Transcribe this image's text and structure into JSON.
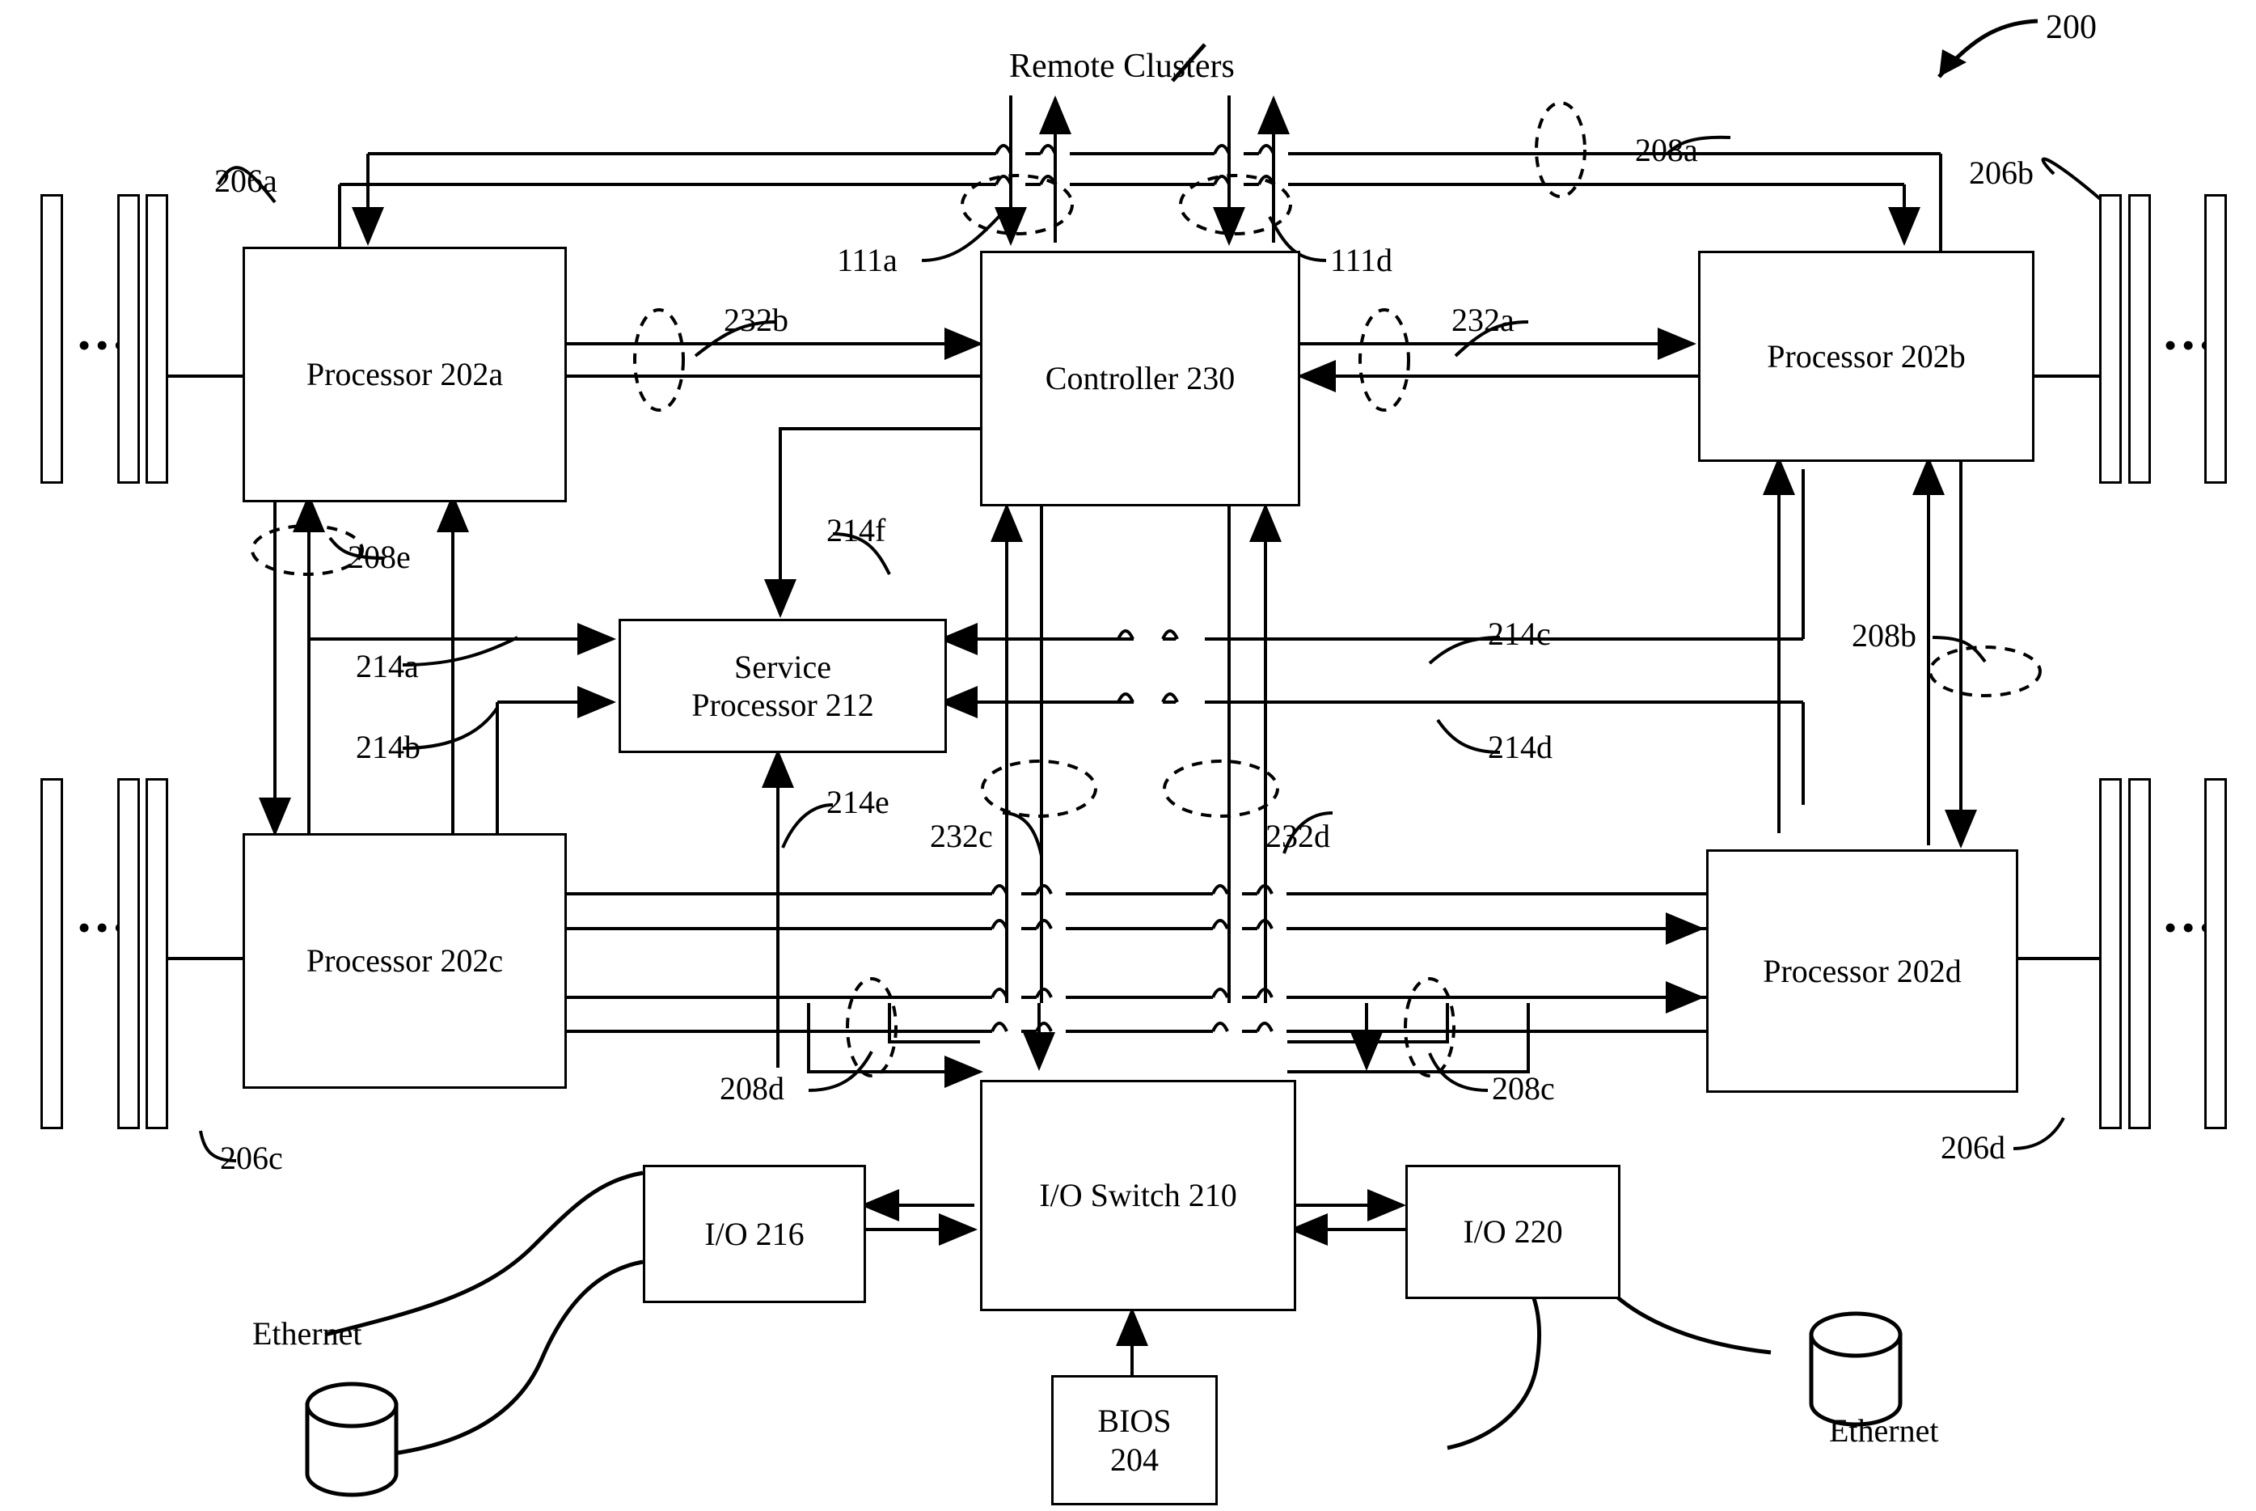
{
  "figure": {
    "ref_number": "200",
    "top_label": "Remote Clusters"
  },
  "blocks": [
    {
      "id": "proc_a",
      "label": "Processor 202a"
    },
    {
      "id": "proc_b",
      "label": "Processor 202b"
    },
    {
      "id": "proc_c",
      "label": "Processor 202c"
    },
    {
      "id": "proc_d",
      "label": "Processor 202d"
    },
    {
      "id": "controller",
      "label": "Controller 230"
    },
    {
      "id": "service_proc",
      "line1": "Service",
      "line2": "Processor 212"
    },
    {
      "id": "io_switch",
      "label": "I/O Switch 210"
    },
    {
      "id": "io_216",
      "label": "I/O 216"
    },
    {
      "id": "io_220",
      "label": "I/O 220"
    },
    {
      "id": "bios",
      "line1": "BIOS",
      "line2": "204"
    }
  ],
  "block_text": {
    "proc_a": "Processor 202a",
    "proc_b": "Processor 202b",
    "proc_c": "Processor 202c",
    "proc_d": "Processor 202d",
    "controller": "Controller 230",
    "service_proc_l1": "Service",
    "service_proc_l2": "Processor 212",
    "io_switch": "I/O Switch 210",
    "io_216": "I/O 216",
    "io_220": "I/O 220",
    "bios_l1": "BIOS",
    "bios_l2": "204"
  },
  "callouts": {
    "ref_200": "200",
    "mem_206a": "206a",
    "mem_206b": "206b",
    "mem_206c": "206c",
    "mem_206d": "206d",
    "link_208a": "208a",
    "link_208b": "208b",
    "link_208c": "208c",
    "link_208d": "208d",
    "link_208e": "208e",
    "link_111a": "111a",
    "link_111d": "111d",
    "link_232a": "232a",
    "link_232b": "232b",
    "link_232c": "232c",
    "link_232d": "232d",
    "link_214a": "214a",
    "link_214b": "214b",
    "link_214c": "214c",
    "link_214d": "214d",
    "link_214e": "214e",
    "link_214f": "214f"
  },
  "network_labels": {
    "ethernet_left": "Ethernet",
    "ethernet_right": "Ethernet"
  },
  "ellipsis": {
    "left_top": "•••",
    "left_bottom": "•••",
    "right_top": "•••",
    "right_bottom": "•••"
  },
  "colors": {
    "line": "#000000",
    "background": "#ffffff"
  }
}
